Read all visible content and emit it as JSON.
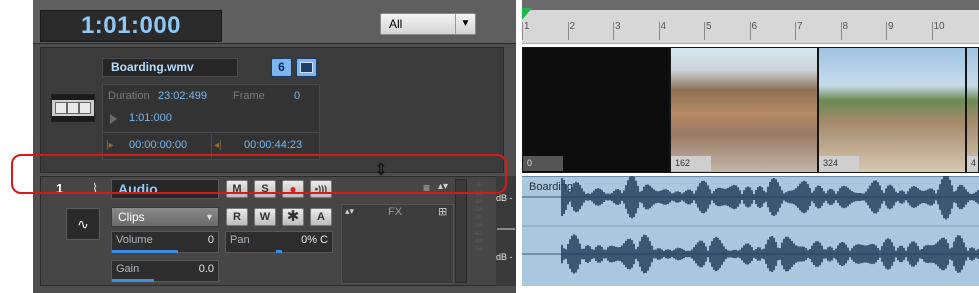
{
  "header": {
    "time": "1:01:000",
    "filter": "All"
  },
  "video_track": {
    "name": "Boarding.wmv",
    "btn_number": "6",
    "duration_label": "Duration",
    "duration_value": "23:02:499",
    "frame_label": "Frame",
    "frame_value": "0",
    "position": "1:01:000",
    "start_time": "00:00:00:00",
    "end_time": "00:00:44:23"
  },
  "audio_track": {
    "number": "1",
    "name": "Audio",
    "buttons": [
      "M",
      "S",
      "●",
      "•)))"
    ],
    "clips_mode": "Clips",
    "edit_buttons": [
      "R",
      "W",
      "✱",
      "A"
    ],
    "fx_label": "FX",
    "volume_label": "Volume",
    "volume_value": "0",
    "volume_level": 0.78,
    "pan_label": "Pan",
    "pan_value": "0% C",
    "pan_level": 0.5,
    "gain_label": "Gain",
    "gain_value": "0.0",
    "gain_level": 0.5,
    "meter_scale": [
      "-6",
      "-12",
      "-18",
      "-24",
      "-30",
      "-36",
      "-42",
      "-48",
      "-54"
    ],
    "db_top": "dB -",
    "db_bottom": "dB -"
  },
  "timeline": {
    "ruler_ticks": [
      "1",
      "2",
      "3",
      "4",
      "5",
      "6",
      "7",
      "8",
      "9",
      "10"
    ],
    "thumbnails": [
      {
        "frame": "0",
        "scene": "black"
      },
      {
        "frame": "162",
        "scene": "graffiti-wall"
      },
      {
        "frame": "324",
        "scene": "skatepark"
      },
      {
        "frame": "4",
        "scene": "skatepark"
      }
    ],
    "clip_name": "Boarding"
  },
  "colors": {
    "time_text": "#8ec8f6",
    "track_name": "#8fcaff",
    "highlight": "#d81919",
    "record_red": "#e0202a",
    "waveform": "#1f3c58",
    "lane_bg": "#a9c7dd"
  },
  "icons": {
    "video_track": "film-strip-icon",
    "audio_track": "audio-waveform-icon",
    "cursor": "resize-vertical-cursor-icon"
  }
}
